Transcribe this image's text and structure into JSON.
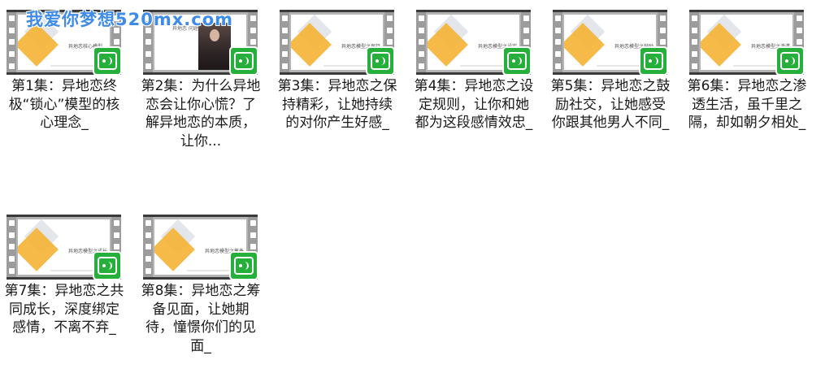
{
  "watermark": "我爱你梦想520mx.com",
  "items": [
    {
      "caption": "第1集：异地恋终极“锁心”模型的核心理念_",
      "slide_title": "异地恋核心模型"
    },
    {
      "caption": "第2集：为什么异地恋会让你心慌？了解异地恋的本质，让你...",
      "slide_title": "异地恋 问题在哪里?"
    },
    {
      "caption": "第3集：异地恋之保持精彩，让她持续的对你产生好感_",
      "slide_title": "异地恋模型之保持"
    },
    {
      "caption": "第4集：异地恋之设定规则，让你和她都为这段感情效忠_",
      "slide_title": "异地恋模型之设定"
    },
    {
      "caption": "第5集：异地恋之鼓励社交，让她感受你跟其他男人不同_",
      "slide_title": "异地恋模型之鼓励"
    },
    {
      "caption": "第6集：异地恋之渗透生活，虽千里之隔，却如朝夕相处_",
      "slide_title": "异地恋模型之渗透"
    },
    {
      "caption": "第7集：异地恋之共同成长，深度绑定感情，不离不弃_",
      "slide_title": "异地恋模型之成长"
    },
    {
      "caption": "第8集：异地恋之筹备见面，让她期待，憧憬你们的见面_",
      "slide_title": "异地恋模型之筹备"
    }
  ]
}
